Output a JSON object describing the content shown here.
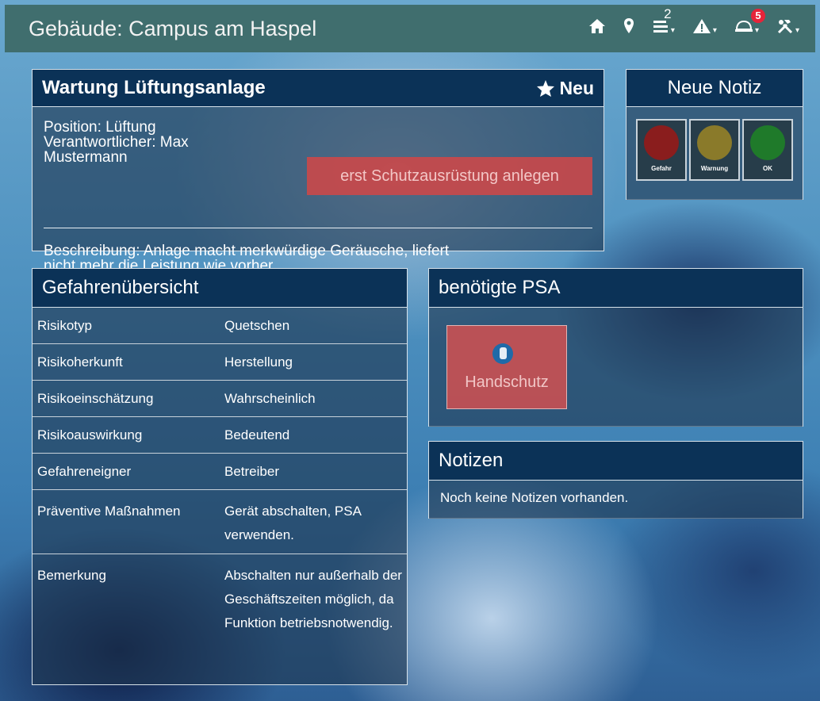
{
  "header": {
    "title": "Gebäude: Campus am Haspel",
    "icons": [
      "home-icon",
      "map-marker-icon",
      "list-icon",
      "warning-icon",
      "helmet-icon",
      "tools-icon"
    ],
    "list_badge": "2",
    "helmet_badge": "5"
  },
  "task": {
    "title": "Wartung Lüftungsanlage",
    "status": "Neu",
    "position": "Position: Lüftung",
    "responsible_1": "Verantwortlicher: Max",
    "responsible_2": "Mustermann",
    "action_button": "erst Schutzausrüstung anlegen",
    "description_1": "Beschreibung: Anlage macht merkwürdige Geräusche, liefert",
    "description_2": "nicht mehr die Leistung wie vorher."
  },
  "new_note": {
    "title": "Neue Notiz",
    "buttons": [
      {
        "label": "Gefahr",
        "color": "#8a1d1d"
      },
      {
        "label": "Warnung",
        "color": "#8a7a2a"
      },
      {
        "label": "OK",
        "color": "#1f7a2a"
      }
    ]
  },
  "hazards": {
    "title": "Gefahrenübersicht",
    "rows": [
      {
        "key": "Risikotyp",
        "value": "Quetschen"
      },
      {
        "key": "Risikoherkunft",
        "value": "Herstellung"
      },
      {
        "key": "Risikoeinschätzung",
        "value": "Wahrscheinlich"
      },
      {
        "key": "Risikoauswirkung",
        "value": "Bedeutend"
      },
      {
        "key": "Gefahreneigner",
        "value": "Betreiber"
      },
      {
        "key": "Präventive Maßnahmen",
        "value": "Gerät abschalten, PSA verwenden."
      },
      {
        "key": "Bemerkung",
        "value": "Abschalten nur außerhalb der Geschäftszeiten möglich, da Funktion betriebsnotwendig."
      }
    ]
  },
  "psa": {
    "title": "benötigte PSA",
    "items": [
      {
        "label": "Handschutz"
      }
    ]
  },
  "notes": {
    "title": "Notizen",
    "empty": "Noch keine Notizen vorhanden."
  }
}
